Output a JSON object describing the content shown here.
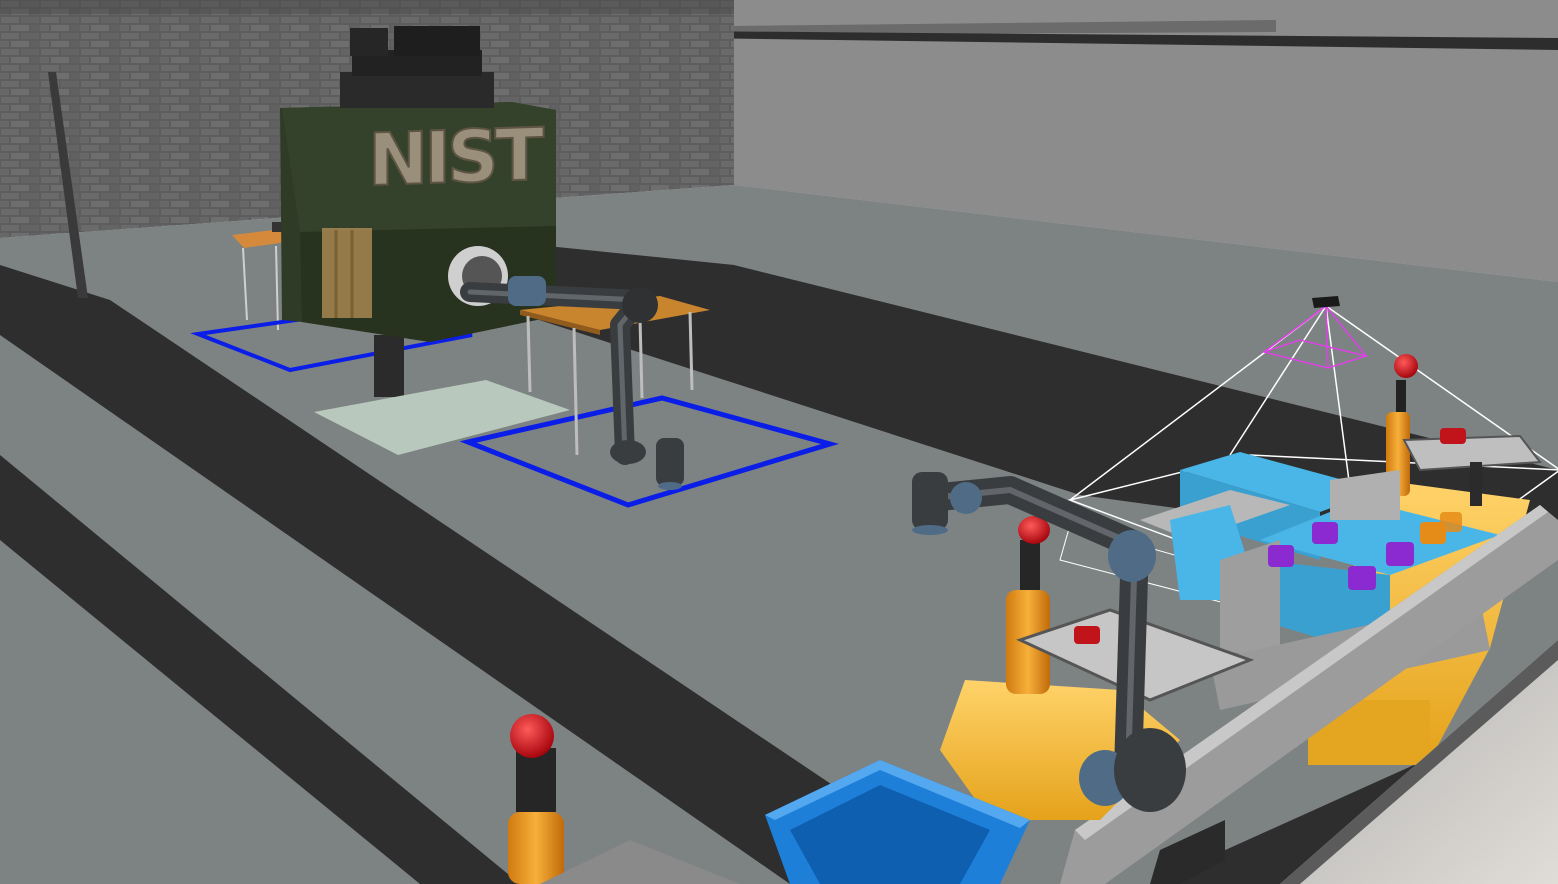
{
  "scene": {
    "type": "3D factory simulation viewport",
    "sign_text": "NIST",
    "colors": {
      "floor": "#7c8282",
      "lane_dark": "#2f2f2f",
      "wall_brick": "#5a5a5a",
      "wall_plain": "#8a8a8a",
      "ceiling": "#c8c8c8",
      "nist_cabinet": "#2e3a26",
      "sign_rust": "#9a8f7a",
      "robot_arm": "#3a3d40",
      "robot_joint": "#4f6b86",
      "agv_yellow": "#f3bf2a",
      "agv_orange": "#f09a1a",
      "beacon_red": "#d40f14",
      "bin_cyan": "#4ab6e8",
      "parts_purple": "#8a2ad0",
      "parts_orange": "#e58b17",
      "parts_red": "#c0141a",
      "bin_blue": "#1e7fd8",
      "zone_blue": "#0b1ee8",
      "camera_frustum": "#ffffff",
      "camera_frustum_inner": "#e040e8"
    }
  }
}
